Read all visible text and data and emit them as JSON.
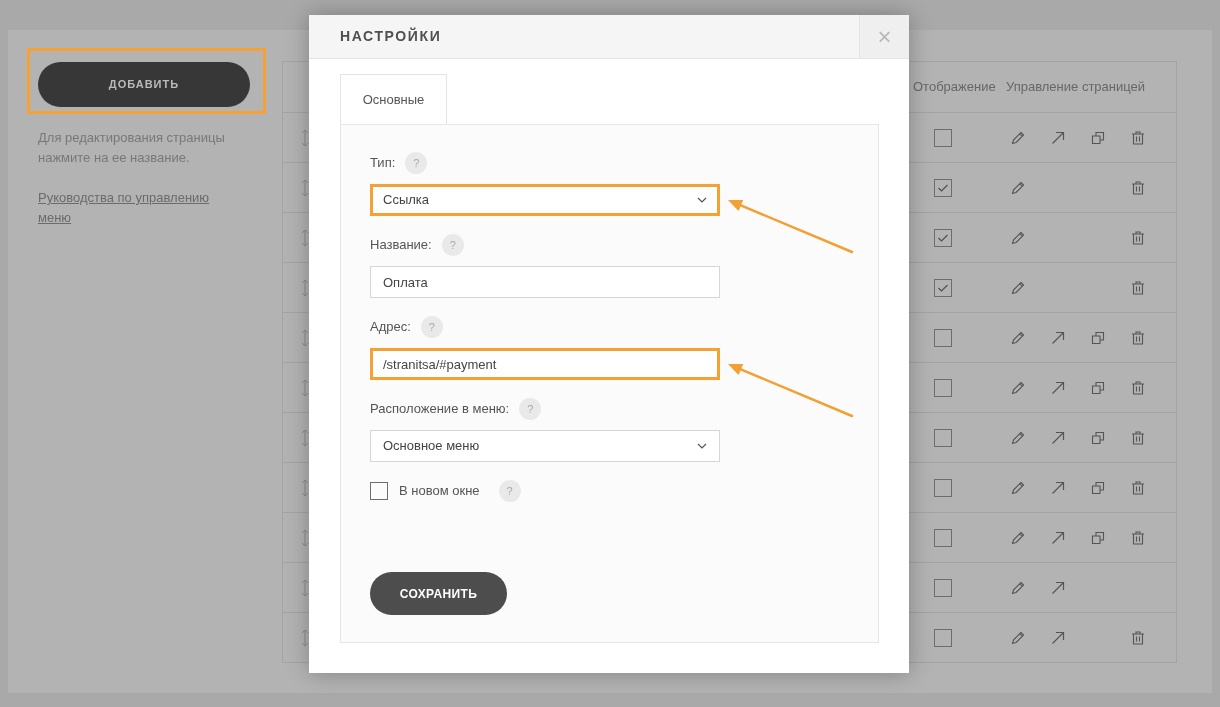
{
  "sidebar": {
    "add_button": {
      "label": "ДОБАВИТЬ",
      "highlighted": true
    },
    "hint": "Для редактирования страницы нажмите на ее название.",
    "guide_link": "Руководства по управлению меню"
  },
  "table": {
    "columns": [
      {
        "kind": "display",
        "label": "Отображение"
      },
      {
        "kind": "actions",
        "label": "Управление страницей"
      }
    ],
    "rows": [
      {
        "displayed": false,
        "actions": [
          {
            "kind": "edit"
          },
          {
            "kind": "open"
          },
          {
            "kind": "copy"
          },
          {
            "kind": "delete"
          }
        ]
      },
      {
        "displayed": true,
        "actions": [
          {
            "kind": "edit"
          },
          {
            "kind": "delete"
          }
        ]
      },
      {
        "displayed": true,
        "actions": [
          {
            "kind": "edit"
          },
          {
            "kind": "delete"
          }
        ]
      },
      {
        "displayed": true,
        "actions": [
          {
            "kind": "edit"
          },
          {
            "kind": "delete"
          }
        ]
      },
      {
        "displayed": false,
        "actions": [
          {
            "kind": "edit"
          },
          {
            "kind": "open"
          },
          {
            "kind": "copy"
          },
          {
            "kind": "delete"
          }
        ]
      },
      {
        "displayed": false,
        "actions": [
          {
            "kind": "edit"
          },
          {
            "kind": "open"
          },
          {
            "kind": "copy"
          },
          {
            "kind": "delete"
          }
        ]
      },
      {
        "displayed": false,
        "actions": [
          {
            "kind": "edit"
          },
          {
            "kind": "open"
          },
          {
            "kind": "copy"
          },
          {
            "kind": "delete"
          }
        ]
      },
      {
        "displayed": false,
        "actions": [
          {
            "kind": "edit"
          },
          {
            "kind": "open"
          },
          {
            "kind": "copy"
          },
          {
            "kind": "delete"
          }
        ]
      },
      {
        "displayed": false,
        "actions": [
          {
            "kind": "edit"
          },
          {
            "kind": "open"
          },
          {
            "kind": "copy"
          },
          {
            "kind": "delete"
          }
        ]
      },
      {
        "displayed": false,
        "actions": [
          {
            "kind": "edit"
          },
          {
            "kind": "open"
          }
        ]
      },
      {
        "displayed": false,
        "actions": [
          {
            "kind": "edit"
          },
          {
            "kind": "open"
          },
          {
            "kind": "delete"
          }
        ]
      }
    ]
  },
  "modal": {
    "title": "НАСТРОЙКИ",
    "close": "×",
    "tabs": [
      {
        "label": "Основные",
        "selected": true
      }
    ],
    "fields": [
      {
        "kind": "select",
        "label": "Тип:",
        "help": "?",
        "value": "Ссылка",
        "highlighted": true
      },
      {
        "kind": "input",
        "label": "Название:",
        "help": "?",
        "value": "Оплата",
        "highlighted": false
      },
      {
        "kind": "input",
        "label": "Адрес:",
        "help": "?",
        "value": "/stranitsa/#payment",
        "highlighted": true
      },
      {
        "kind": "select",
        "label": "Расположение в меню:",
        "help": "?",
        "value": "Основное меню",
        "highlighted": false
      },
      {
        "kind": "checkbox",
        "label": "В новом окне",
        "help": "?",
        "checked": false
      }
    ],
    "save_button": "СОХРАНИТЬ"
  }
}
